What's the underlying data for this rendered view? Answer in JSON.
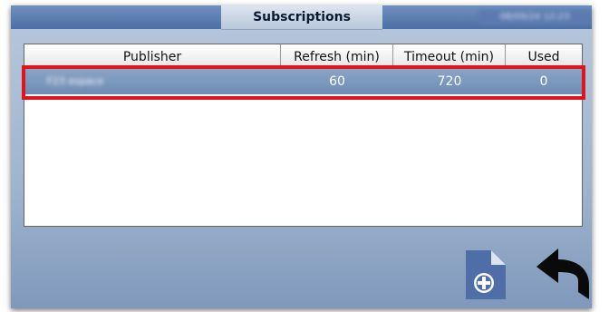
{
  "header": {
    "title": "Subscriptions",
    "datetime": "08/09/24 12:23"
  },
  "table": {
    "columns": [
      "Publisher",
      "Refresh (min)",
      "Timeout (min)",
      "Used"
    ],
    "rows": [
      {
        "publisher": "F23 espace",
        "refresh": "60",
        "timeout": "720",
        "used": "0"
      }
    ]
  },
  "colors": {
    "highlight": "#e0141c",
    "add_button": "#4f6ea8",
    "back_button": "#0a0a0a"
  },
  "icons": {
    "add": "add-document-icon",
    "back": "back-arrow-icon"
  }
}
